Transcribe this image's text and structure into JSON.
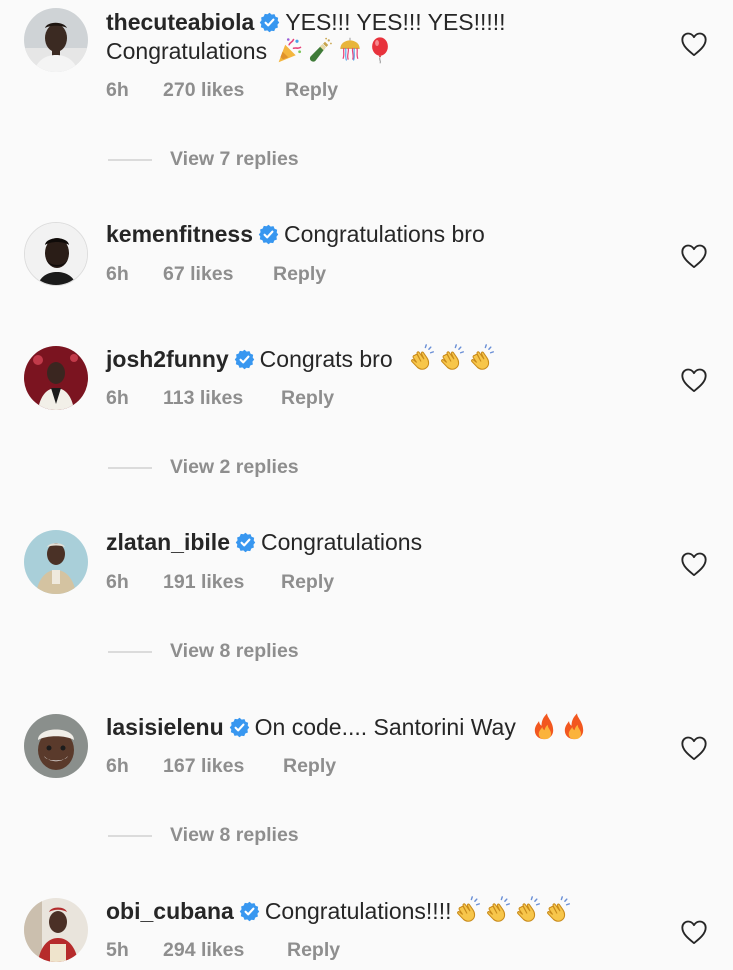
{
  "comments": [
    {
      "username": "thecuteabiola",
      "text": "YES!!! YES!!! YES!!!!!",
      "text2": "Congratulations",
      "emojis2": [
        "party-popper",
        "champagne",
        "confetti-ball",
        "balloon"
      ],
      "time": "6h",
      "likes": "270 likes",
      "reply": "Reply",
      "view_replies": "View 7 replies"
    },
    {
      "username": "kemenfitness",
      "text": "Congratulations bro",
      "time": "6h",
      "likes": "67 likes",
      "reply": "Reply"
    },
    {
      "username": "josh2funny",
      "text": "Congrats bro",
      "emojis": [
        "clapping-hands",
        "clapping-hands",
        "clapping-hands"
      ],
      "time": "6h",
      "likes": "113 likes",
      "reply": "Reply",
      "view_replies": "View 2 replies"
    },
    {
      "username": "zlatan_ibile",
      "text": "Congratulations",
      "time": "6h",
      "likes": "191 likes",
      "reply": "Reply",
      "view_replies": "View 8 replies"
    },
    {
      "username": "lasisielenu",
      "text": "On code.... Santorini Way",
      "emojis": [
        "fire",
        "fire"
      ],
      "time": "6h",
      "likes": "167 likes",
      "reply": "Reply",
      "view_replies": "View 8 replies"
    },
    {
      "username": "obi_cubana",
      "text": "Congratulations!!!!",
      "emojis": [
        "clapping-hands",
        "clapping-hands",
        "clapping-hands",
        "clapping-hands"
      ],
      "time": "5h",
      "likes": "294 likes",
      "reply": "Reply"
    }
  ],
  "colors": {
    "background": "#fafafa",
    "text": "#262626",
    "secondary": "#8e8e8e",
    "verified": "#3897f0",
    "divider": "#dbdbdb"
  }
}
